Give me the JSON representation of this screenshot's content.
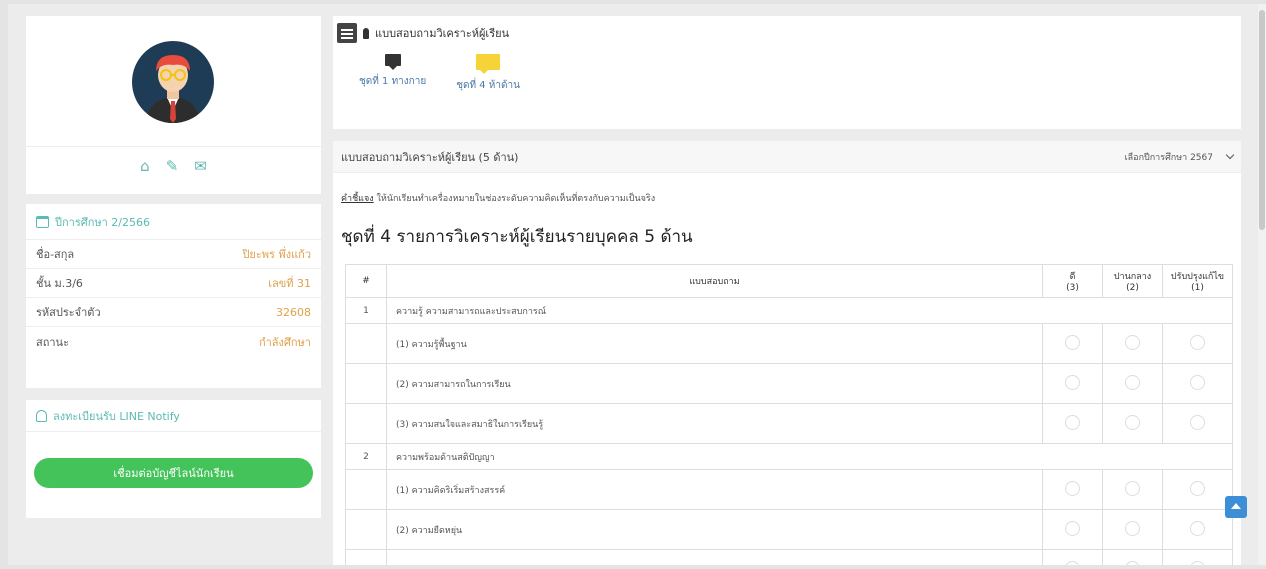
{
  "profile": {
    "actions": [
      "home-icon",
      "pencil-icon",
      "mail-icon"
    ]
  },
  "info": {
    "header": "ปีการศึกษา 2/2566",
    "rows": [
      {
        "label": "ชื่อ-สกุล",
        "value": "ปิยะพร พึ่งแก้ว"
      },
      {
        "label": "ชั้น ม.3/6",
        "value": "เลขที่ 31"
      },
      {
        "label": "รหัสประจำตัว",
        "value": "32608"
      },
      {
        "label": "สถานะ",
        "value": "กำลังศึกษา"
      }
    ]
  },
  "notify": {
    "header": "ลงทะเบียนรับ LINE Notify",
    "button": "เชื่อมต่อบัญชีไลน์นักเรียน"
  },
  "top": {
    "title": "แบบสอบถามวิเคราะห์ผู้เรียน",
    "tabs": [
      "ชุดที่ 1 ทางกาย",
      "ชุดที่ 4 ห้าด้าน"
    ]
  },
  "main": {
    "header": "แบบสอบถามวิเคราะห์ผู้เรียน (5 ด้าน)",
    "year_select": "เลือกปีการศึกษา 2567",
    "note_label": "คำชี้แจง",
    "note": "ให้นักเรียนทำเครื่องหมายในช่องระดับความคิดเห็นที่ตรงกับความเป็นจริง",
    "title": "ชุดที่ 4 รายการวิเคราะห์ผู้เรียนรายบุคคล 5 ด้าน",
    "columns": {
      "num": "#",
      "question": "แบบสอบถาม",
      "c1": "ดี",
      "c1s": "(3)",
      "c2": "ปานกลาง",
      "c2s": "(2)",
      "c3": "ปรับปรุงแก้ไข",
      "c3s": "(1)"
    },
    "rows": [
      {
        "type": "section",
        "num": "1",
        "text": "ความรู้ ความสามารถและประสบการณ์"
      },
      {
        "type": "item",
        "text": "(1) ความรู้พื้นฐาน"
      },
      {
        "type": "item",
        "text": "(2) ความสามารถในการเรียน"
      },
      {
        "type": "item",
        "text": "(3) ความสนใจและสมาธิในการเรียนรู้"
      },
      {
        "type": "section",
        "num": "2",
        "text": "ความพร้อมด้านสติปัญญา"
      },
      {
        "type": "item",
        "text": "(1) ความคิดริเริ่มสร้างสรรค์"
      },
      {
        "type": "item",
        "text": "(2) ความยืดหยุ่น"
      },
      {
        "type": "item",
        "text": ""
      }
    ]
  },
  "colors": {
    "accent": "#5abab4",
    "value": "#e0a04a",
    "line_button": "#43c35a",
    "tab_active": "#f7d33a",
    "scroll_top": "#3c8ed6"
  }
}
